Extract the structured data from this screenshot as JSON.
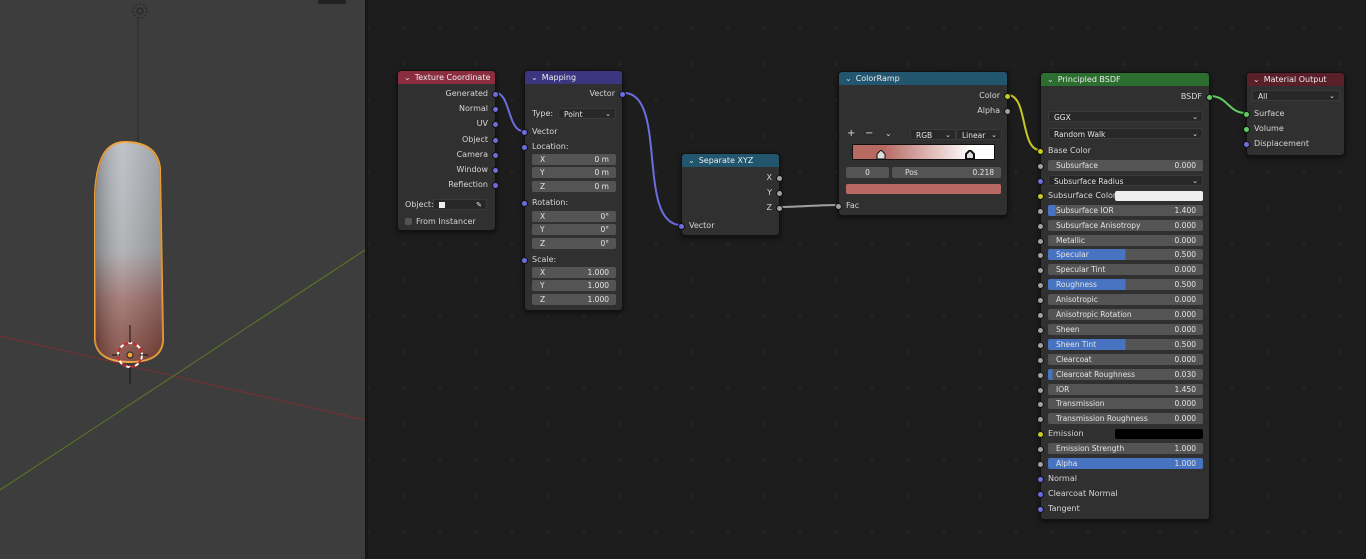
{
  "colors": {
    "texcoord_header": "#8a2d3f",
    "mapping_header": "#3c3681",
    "separate_header": "#22566f",
    "colorramp_header": "#22566f",
    "principled_header": "#2b6e2f",
    "output_header": "#5a1f28",
    "vector_socket": "#6d6de0",
    "color_socket": "#c7c729",
    "float_socket": "#a1a1a1",
    "shader_socket": "#62cc62",
    "selection_outline": "#f0a23b",
    "slider_fill": "#4773c1"
  },
  "viewport": {
    "icons": {
      "camera": "camera-icon",
      "origin": "origin-icon",
      "cursor": "3d-cursor-icon"
    }
  },
  "nodes": {
    "texcoord": {
      "title": "Texture Coordinate",
      "outputs": [
        "Generated",
        "Normal",
        "UV",
        "Object",
        "Camera",
        "Window",
        "Reflection"
      ],
      "object_label": "Object:",
      "from_instancer": "From Instancer"
    },
    "mapping": {
      "title": "Mapping",
      "output": "Vector",
      "type_label": "Type:",
      "type_value": "Point",
      "vector_label": "Vector",
      "location_label": "Location:",
      "location": [
        [
          "X",
          "0 m"
        ],
        [
          "Y",
          "0 m"
        ],
        [
          "Z",
          "0 m"
        ]
      ],
      "rotation_label": "Rotation:",
      "rotation": [
        [
          "X",
          "0°"
        ],
        [
          "Y",
          "0°"
        ],
        [
          "Z",
          "0°"
        ]
      ],
      "scale_label": "Scale:",
      "scale": [
        [
          "X",
          "1.000"
        ],
        [
          "Y",
          "1.000"
        ],
        [
          "Z",
          "1.000"
        ]
      ]
    },
    "separate": {
      "title": "Separate XYZ",
      "outputs": [
        "X",
        "Y",
        "Z"
      ],
      "input": "Vector"
    },
    "colorramp": {
      "title": "ColorRamp",
      "outputs": [
        "Color",
        "Alpha"
      ],
      "plus": "+",
      "minus": "−",
      "menu": "⌄",
      "mode": "RGB",
      "interp": "Linear",
      "stop_index": "0",
      "pos_label": "Pos",
      "pos_value": "0.218",
      "stop_color": "#b86a62",
      "input": "Fac"
    },
    "principled": {
      "title": "Principled BSDF",
      "output": "BSDF",
      "distribution": "GGX",
      "subsurface_method": "Random Walk",
      "base_color": "Base Color",
      "fields": [
        {
          "label": "Subsurface",
          "value": "0.000",
          "fill": 0
        },
        {
          "label": "Subsurface Radius",
          "value": "",
          "dropdown": true
        },
        {
          "label": "Subsurface Color",
          "value": "",
          "color": "#ededed",
          "plain": true
        },
        {
          "label": "Subsurface IOR",
          "value": "1.400",
          "fill": 0.05
        },
        {
          "label": "Subsurface Anisotropy",
          "value": "0.000",
          "fill": 0
        },
        {
          "label": "Metallic",
          "value": "0.000",
          "fill": 0
        },
        {
          "label": "Specular",
          "value": "0.500",
          "fill": 0.5
        },
        {
          "label": "Specular Tint",
          "value": "0.000",
          "fill": 0
        },
        {
          "label": "Roughness",
          "value": "0.500",
          "fill": 0.5
        },
        {
          "label": "Anisotropic",
          "value": "0.000",
          "fill": 0
        },
        {
          "label": "Anisotropic Rotation",
          "value": "0.000",
          "fill": 0
        },
        {
          "label": "Sheen",
          "value": "0.000",
          "fill": 0
        },
        {
          "label": "Sheen Tint",
          "value": "0.500",
          "fill": 0.5
        },
        {
          "label": "Clearcoat",
          "value": "0.000",
          "fill": 0
        },
        {
          "label": "Clearcoat Roughness",
          "value": "0.030",
          "fill": 0.03
        },
        {
          "label": "IOR",
          "value": "1.450",
          "fill": 0
        },
        {
          "label": "Transmission",
          "value": "0.000",
          "fill": 0
        },
        {
          "label": "Transmission Roughness",
          "value": "0.000",
          "fill": 0
        },
        {
          "label": "Emission",
          "value": "",
          "color": "#000000",
          "plain": true
        },
        {
          "label": "Emission Strength",
          "value": "1.000",
          "fill": 0
        },
        {
          "label": "Alpha",
          "value": "1.000",
          "fill": 1
        }
      ],
      "tail": [
        "Normal",
        "Clearcoat Normal",
        "Tangent"
      ]
    },
    "output": {
      "title": "Material Output",
      "target": "All",
      "inputs": [
        "Surface",
        "Volume",
        "Displacement"
      ]
    }
  }
}
